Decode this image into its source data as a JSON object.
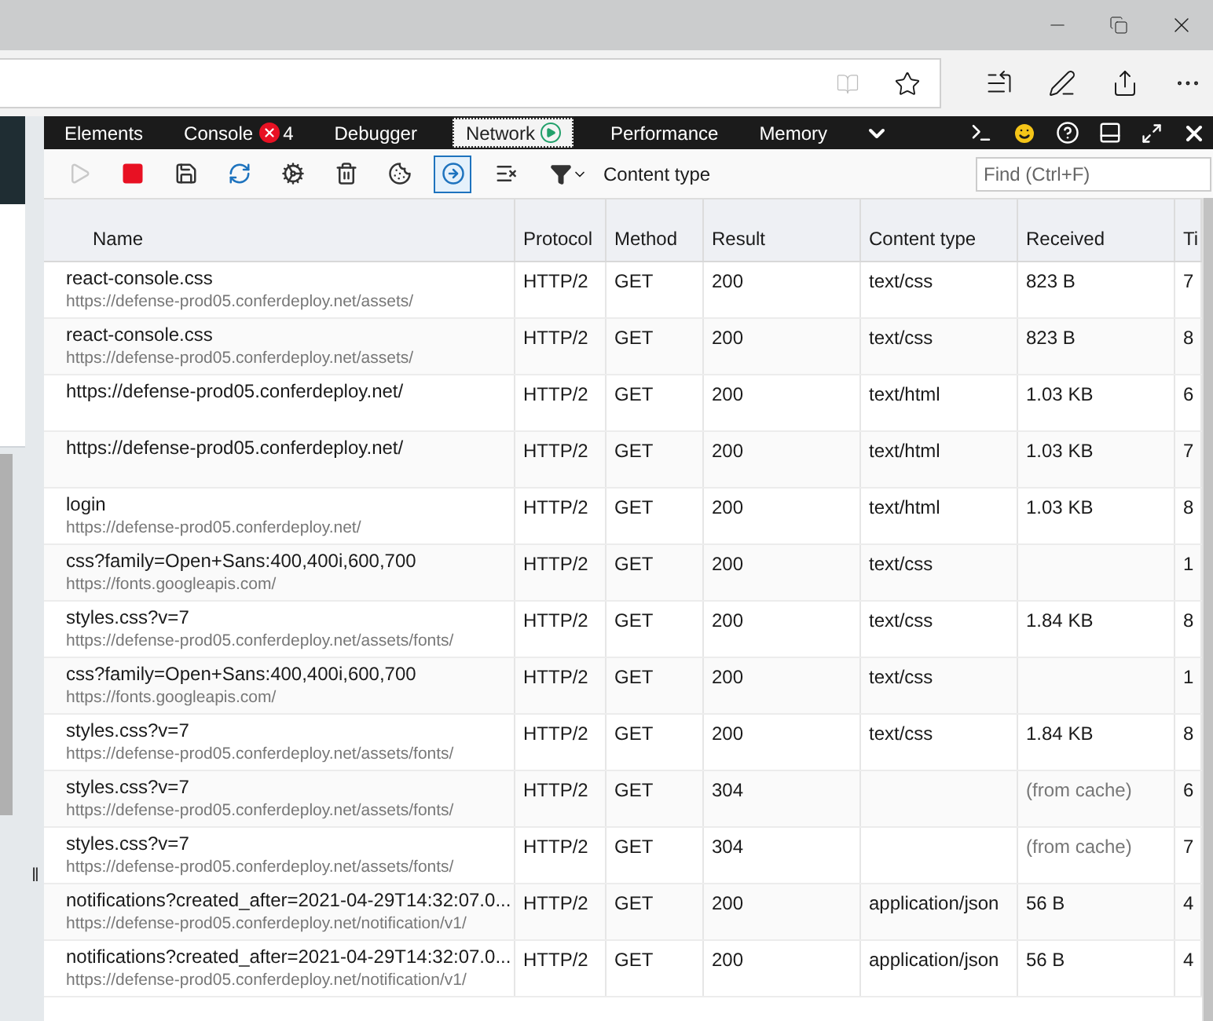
{
  "devtools": {
    "tabs": [
      {
        "label": "Elements",
        "selected": false
      },
      {
        "label": "Console",
        "selected": false,
        "error_count": "4"
      },
      {
        "label": "Debugger",
        "selected": false
      },
      {
        "label": "Network",
        "selected": true,
        "recording": true
      },
      {
        "label": "Performance",
        "selected": false
      },
      {
        "label": "Memory",
        "selected": false
      }
    ],
    "toolbar": {
      "buttons": [
        {
          "kind": "start",
          "disabled": true,
          "selected": false
        },
        {
          "kind": "stop",
          "disabled": false,
          "selected": false
        },
        {
          "kind": "export",
          "disabled": false,
          "selected": false
        },
        {
          "kind": "always-refresh",
          "disabled": false,
          "selected": false
        },
        {
          "kind": "network-conditions",
          "disabled": false,
          "selected": false
        },
        {
          "kind": "clear-session",
          "disabled": false,
          "selected": false
        },
        {
          "kind": "clear-cookies",
          "disabled": false,
          "selected": false
        },
        {
          "kind": "bypass-cache",
          "disabled": false,
          "selected": true
        },
        {
          "kind": "clear-entries",
          "disabled": false,
          "selected": false
        }
      ],
      "filter_label": "Content type",
      "find": {
        "placeholder": "Find (Ctrl+F)"
      }
    },
    "splitter": "‖",
    "table": {
      "columns": [
        "Name",
        "Protocol",
        "Method",
        "Result",
        "Content type",
        "Received",
        "Ti"
      ],
      "rows": [
        {
          "name": "react-console.css",
          "url": "https://defense-prod05.conferdeploy.net/assets/",
          "protocol": "HTTP/2",
          "method": "GET",
          "result": "200",
          "content_type": "text/css",
          "received": "823 B",
          "column_7": "7"
        },
        {
          "name": "react-console.css",
          "url": "https://defense-prod05.conferdeploy.net/assets/",
          "protocol": "HTTP/2",
          "method": "GET",
          "result": "200",
          "content_type": "text/css",
          "received": "823 B",
          "column_7": "8"
        },
        {
          "name": "https://defense-prod05.conferdeploy.net/",
          "protocol": "HTTP/2",
          "method": "GET",
          "result": "200",
          "content_type": "text/html",
          "received": "1.03 KB",
          "column_7": "6"
        },
        {
          "name": "https://defense-prod05.conferdeploy.net/",
          "protocol": "HTTP/2",
          "method": "GET",
          "result": "200",
          "content_type": "text/html",
          "received": "1.03 KB",
          "column_7": "7"
        },
        {
          "name": "login",
          "url": "https://defense-prod05.conferdeploy.net/",
          "protocol": "HTTP/2",
          "method": "GET",
          "result": "200",
          "content_type": "text/html",
          "received": "1.03 KB",
          "column_7": "8"
        },
        {
          "name": "css?family=Open+Sans:400,400i,600,700",
          "url": "https://fonts.googleapis.com/",
          "protocol": "HTTP/2",
          "method": "GET",
          "result": "200",
          "content_type": "text/css",
          "column_7": "1"
        },
        {
          "name": "styles.css?v=7",
          "url": "https://defense-prod05.conferdeploy.net/assets/fonts/",
          "protocol": "HTTP/2",
          "method": "GET",
          "result": "200",
          "content_type": "text/css",
          "received": "1.84 KB",
          "column_7": "8"
        },
        {
          "name": "css?family=Open+Sans:400,400i,600,700",
          "url": "https://fonts.googleapis.com/",
          "protocol": "HTTP/2",
          "method": "GET",
          "result": "200",
          "content_type": "text/css",
          "column_7": "1"
        },
        {
          "name": "styles.css?v=7",
          "url": "https://defense-prod05.conferdeploy.net/assets/fonts/",
          "protocol": "HTTP/2",
          "method": "GET",
          "result": "200",
          "content_type": "text/css",
          "received": "1.84 KB",
          "column_7": "8"
        },
        {
          "name": "styles.css?v=7",
          "url": "https://defense-prod05.conferdeploy.net/assets/fonts/",
          "protocol": "HTTP/2",
          "method": "GET",
          "result": "304",
          "received": "(from cache)",
          "cached": true,
          "column_7": "6"
        },
        {
          "name": "styles.css?v=7",
          "url": "https://defense-prod05.conferdeploy.net/assets/fonts/",
          "protocol": "HTTP/2",
          "method": "GET",
          "result": "304",
          "received": "(from cache)",
          "cached": true,
          "column_7": "7"
        },
        {
          "name": "notifications?created_after=2021-04-29T14:32:07.0...",
          "url": "https://defense-prod05.conferdeploy.net/notification/v1/",
          "protocol": "HTTP/2",
          "method": "GET",
          "result": "200",
          "content_type": "application/json",
          "received": "56 B",
          "column_7": "4"
        },
        {
          "name": "notifications?created_after=2021-04-29T14:32:07.0...",
          "url": "https://defense-prod05.conferdeploy.net/notification/v1/",
          "protocol": "HTTP/2",
          "method": "GET",
          "result": "200",
          "content_type": "application/json",
          "received": "56 B",
          "column_7": "4"
        }
      ]
    }
  }
}
